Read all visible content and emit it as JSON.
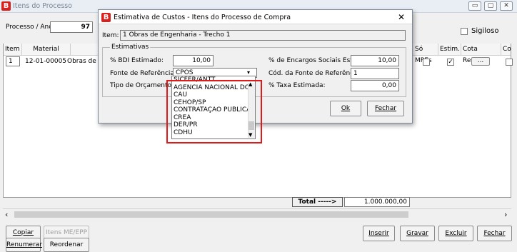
{
  "window": {
    "title": "Itens do Processo"
  },
  "header": {
    "process_label": "Processo / Ano:",
    "process_value": "97",
    "sigiloso_label": "Sigiloso"
  },
  "grid": {
    "columns": [
      "Item",
      "Material",
      "Só MPEs",
      "Estim.",
      "Cota Reserv.",
      "Co"
    ],
    "row": {
      "item": "1",
      "material": "12-01-00005",
      "desc": "Obras de E",
      "estim_checked": "✓",
      "cota": "..."
    }
  },
  "total": {
    "label": "Total ----->",
    "value": "1.000.000,00"
  },
  "bottom_buttons": {
    "copiar": "Copiar",
    "itens_me": "Itens ME/EPP",
    "renumerar": "Renumerar",
    "reordenar": "Reordenar",
    "inserir": "Inserir",
    "gravar": "Gravar",
    "excluir": "Excluir",
    "fechar": "Fechar"
  },
  "dialog": {
    "title": "Estimativa de Custos - Itens do Processo de Compra",
    "close": "✕",
    "item_label": "Item:",
    "item_value": "1 Obras de Engenharia - Trecho 1",
    "group_title": "Estimativas",
    "bdi_label": "% BDI Estimado:",
    "bdi_value": "10,00",
    "fonte_label": "Fonte de Referência:",
    "fonte_value": "CPOS",
    "tipo_label": "Tipo de Orçamento:",
    "encargos_label": "% de Encargos Sociais Estimado:",
    "encargos_value": "10,00",
    "cod_fonte_label": "Cód. da Fonte de Referência:",
    "cod_fonte_value": "1",
    "taxa_label": "% Taxa Estimada:",
    "taxa_value": "0,00",
    "ok": "Ok",
    "fechar": "Fechar",
    "dropdown_options": [
      "SICFER/ANTT",
      "AGÊNCIA NACIONAL DO P",
      "CAU",
      "CEHOP/SP",
      "CONTRATAÇÃO PÚBLICA",
      "CREA",
      "DER/PR",
      "CDHU"
    ]
  }
}
